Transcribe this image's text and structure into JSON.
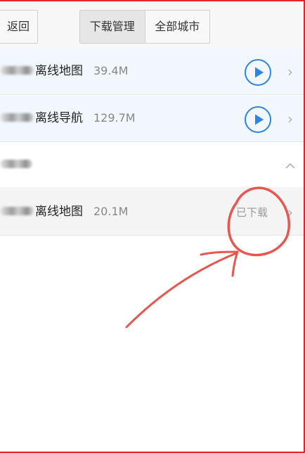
{
  "toolbar": {
    "back_label": "返回",
    "tabs": [
      {
        "label": "下载管理",
        "selected": true
      },
      {
        "label": "全部城市",
        "selected": false
      }
    ]
  },
  "rows": [
    {
      "title": "离线地图",
      "size": "39.4M",
      "action": "play-icon"
    },
    {
      "title": "离线导航",
      "size": "129.7M",
      "action": "play-icon"
    },
    {
      "title": "",
      "size": "",
      "action": "chevron-up-icon"
    },
    {
      "title": "离线地图",
      "size": "20.1M",
      "status": "已下载"
    }
  ],
  "colors": {
    "accent": "#2d85e2",
    "annotation": "#e85650",
    "frame": "#e0262b"
  }
}
